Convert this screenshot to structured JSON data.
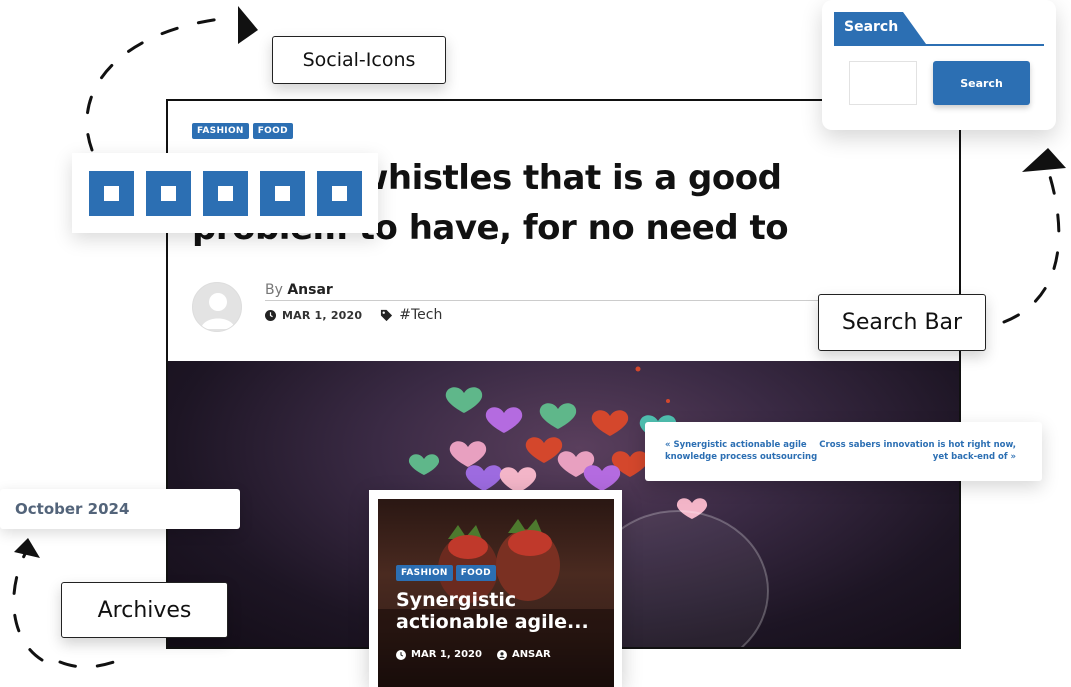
{
  "labels": {
    "social": "Social-Icons",
    "search": "Search Bar",
    "archives": "Archives"
  },
  "post": {
    "categories": [
      "FASHION",
      "FOOD"
    ],
    "title_line1": "whistles that is a good",
    "title_line2": "problem to have, for no need to",
    "by": "By",
    "author": "Ansar",
    "date": "MAR 1, 2020",
    "tag": "#Tech"
  },
  "social": {
    "icons": [
      "social-icon-1",
      "social-icon-2",
      "social-icon-3",
      "social-icon-4",
      "social-icon-5"
    ]
  },
  "search_widget": {
    "title": "Search",
    "button_label": "Search",
    "input_value": ""
  },
  "post_nav": {
    "prev": "« Synergistic actionable agile knowledge process outsourcing",
    "next": "Cross sabers innovation is hot right now, yet back-end of »"
  },
  "archive": {
    "item": "October 2024"
  },
  "feature": {
    "categories": [
      "FASHION",
      "FOOD"
    ],
    "title": "Synergistic actionable agile...",
    "date": "MAR 1, 2020",
    "author": "ANSAR"
  },
  "colors": {
    "accent": "#2c6fb3",
    "archive_text": "#53647a"
  }
}
